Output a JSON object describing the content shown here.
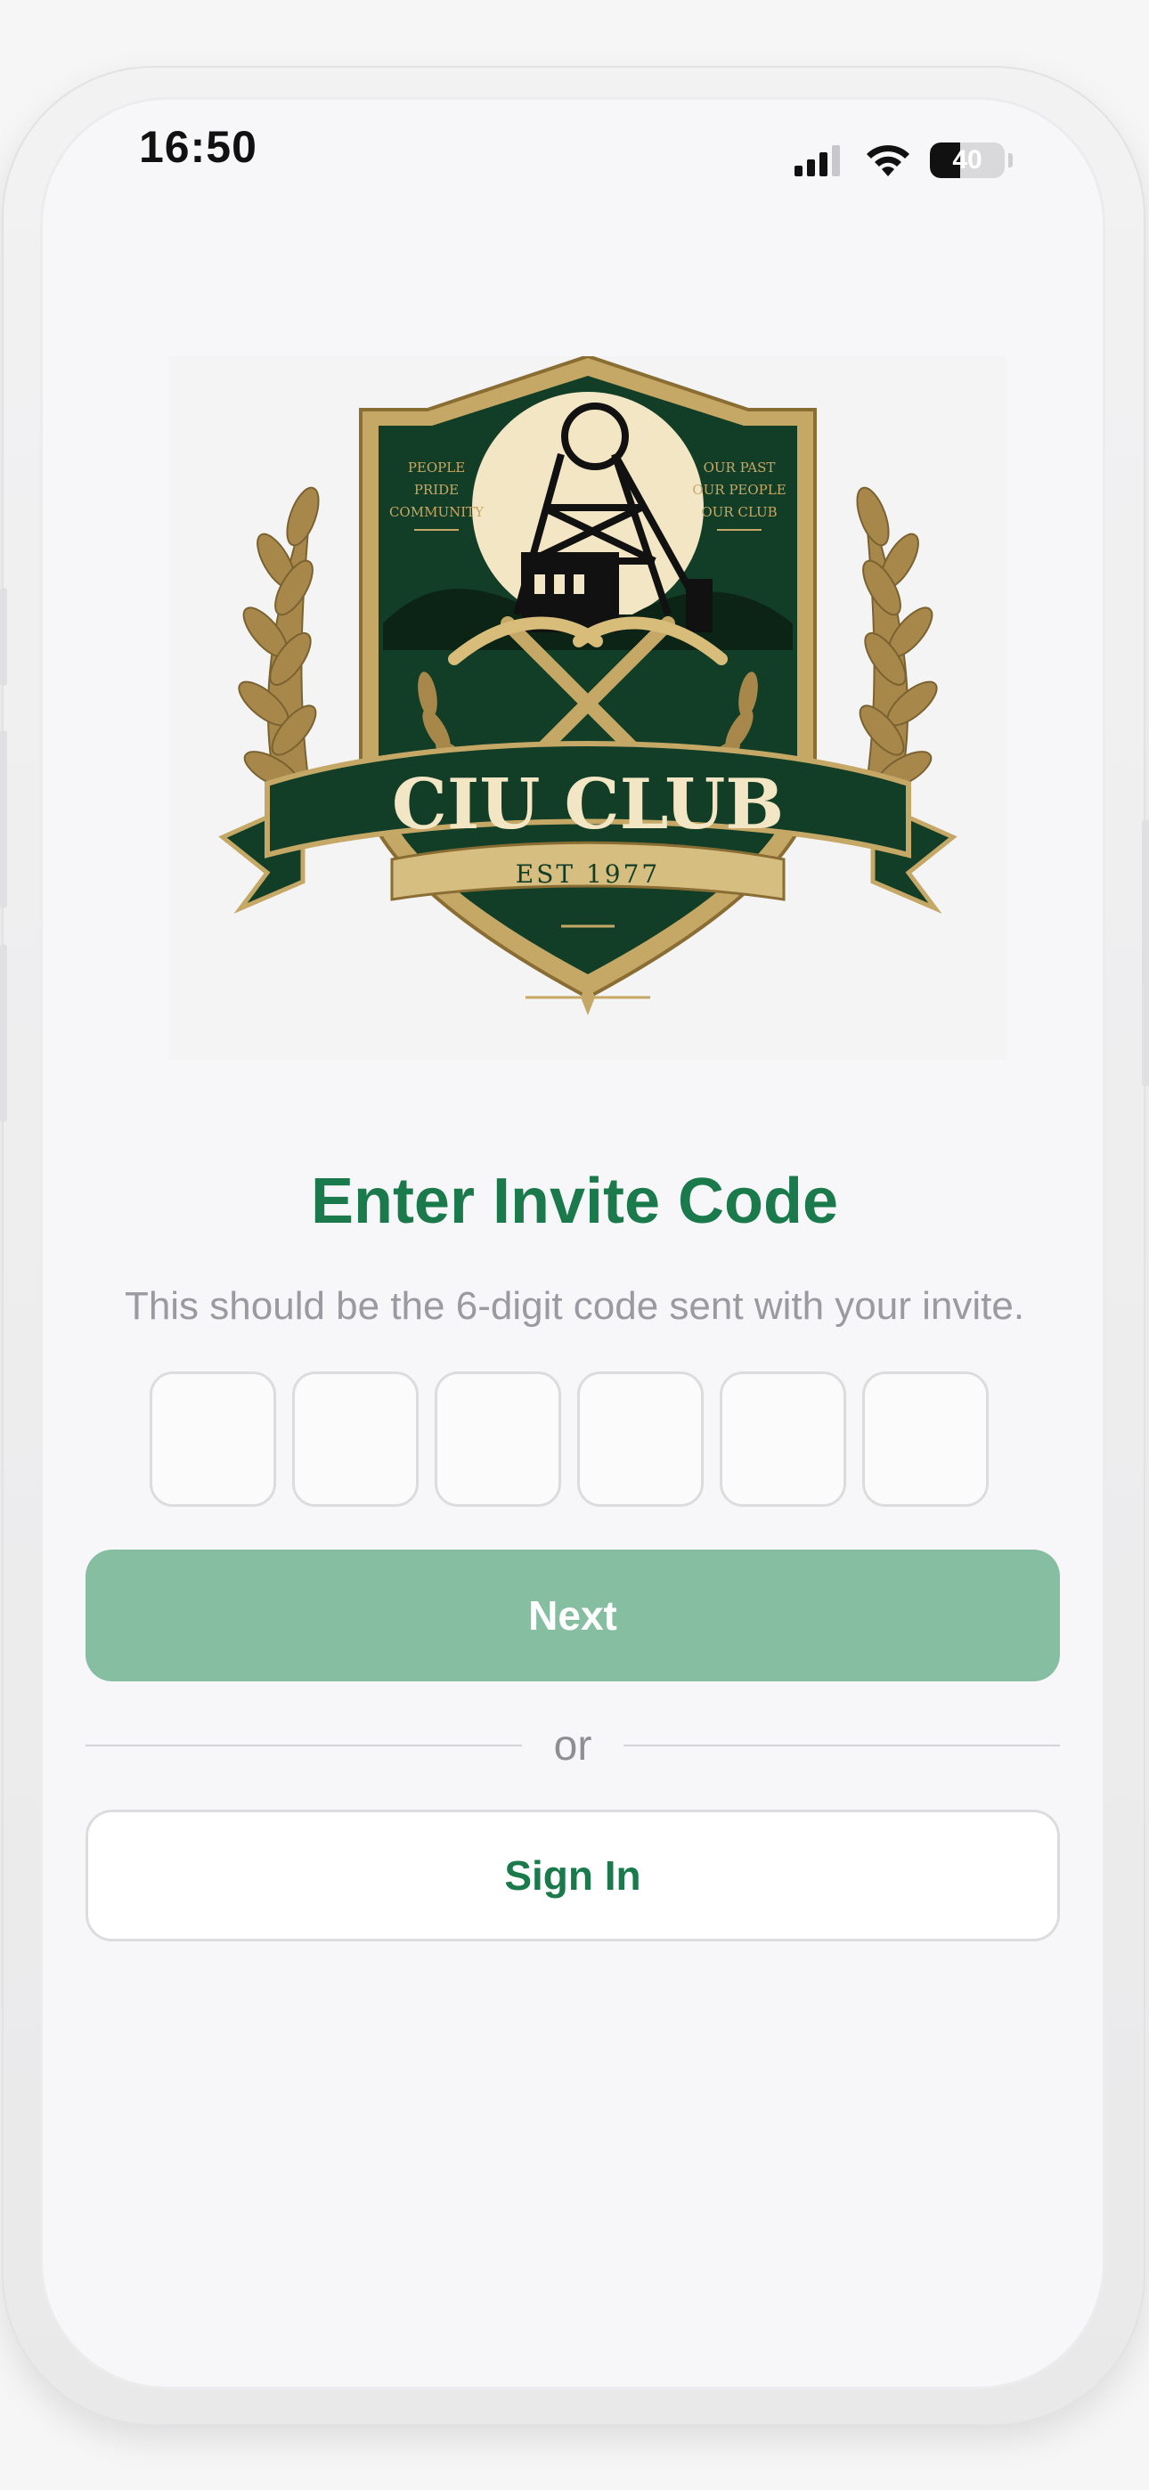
{
  "status_bar": {
    "time": "16:50",
    "battery_level": "40",
    "battery_fraction": 0.4
  },
  "logo": {
    "club_name": "CIU CLUB",
    "established": "EST 1977",
    "left_motto": [
      "PEOPLE",
      "PRIDE",
      "COMMUNITY"
    ],
    "right_motto": [
      "OUR PAST",
      "OUR PEOPLE",
      "OUR CLUB"
    ],
    "colors": {
      "shield_green": "#0f3b24",
      "gold": "#b99a55",
      "cream": "#f3e6c4"
    }
  },
  "invite": {
    "title": "Enter Invite Code",
    "subtitle": "This should be the 6-digit code sent with your invite.",
    "code_digits": [
      "",
      "",
      "",
      "",
      "",
      ""
    ]
  },
  "actions": {
    "next_label": "Next",
    "divider_text": "or",
    "signin_label": "Sign In"
  },
  "colors": {
    "brand_green": "#1a7a4c",
    "next_button_disabled": "#86bea2"
  }
}
